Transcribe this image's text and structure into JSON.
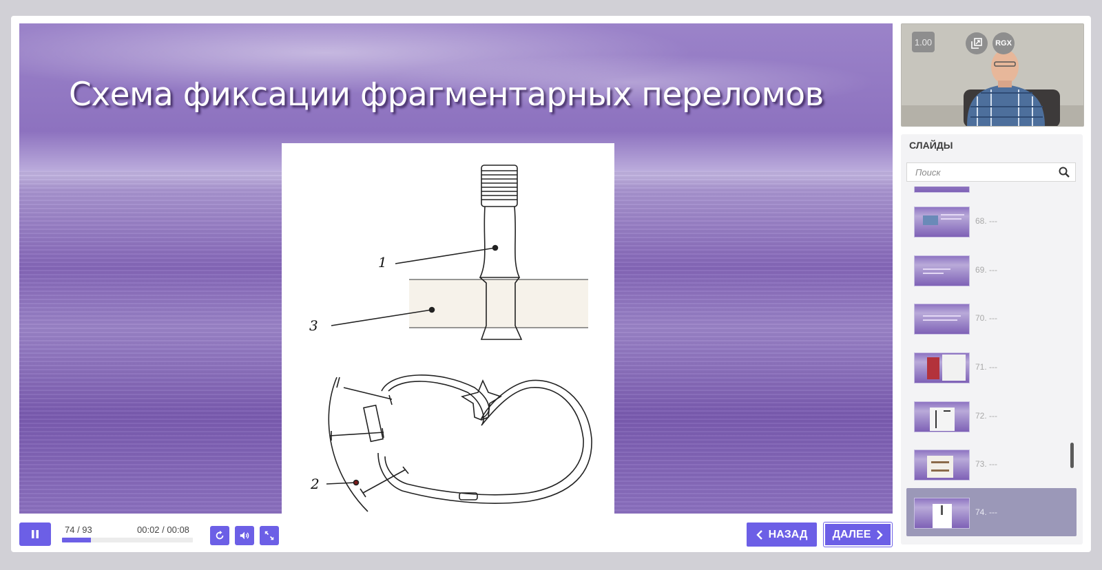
{
  "slide": {
    "title": "Схема фиксации фрагментарных переломов",
    "figure_labels": [
      "1",
      "3",
      "2"
    ]
  },
  "player": {
    "counter": "74 / 93",
    "time": "00:02 / 00:08",
    "progress_fraction": 0.22,
    "prev_label": "НАЗАД",
    "next_label": "ДАЛЕЕ"
  },
  "video": {
    "speed": "1.00",
    "rgx_label": "RGX"
  },
  "sidebar": {
    "title": "СЛАЙДЫ",
    "search_placeholder": "Поиск",
    "items": [
      {
        "label": "68. ---"
      },
      {
        "label": "69. ---"
      },
      {
        "label": "70. ---"
      },
      {
        "label": "71. ---"
      },
      {
        "label": "72. ---"
      },
      {
        "label": "73. ---"
      },
      {
        "label": "74. ---",
        "active": true
      }
    ]
  },
  "colors": {
    "accent": "#6c5fe6",
    "active_item": "#9b98b8"
  },
  "icons": [
    "pause-icon",
    "replay-icon",
    "volume-icon",
    "fullscreen-icon",
    "chevron-left-icon",
    "chevron-right-icon",
    "popout-icon",
    "search-icon"
  ]
}
